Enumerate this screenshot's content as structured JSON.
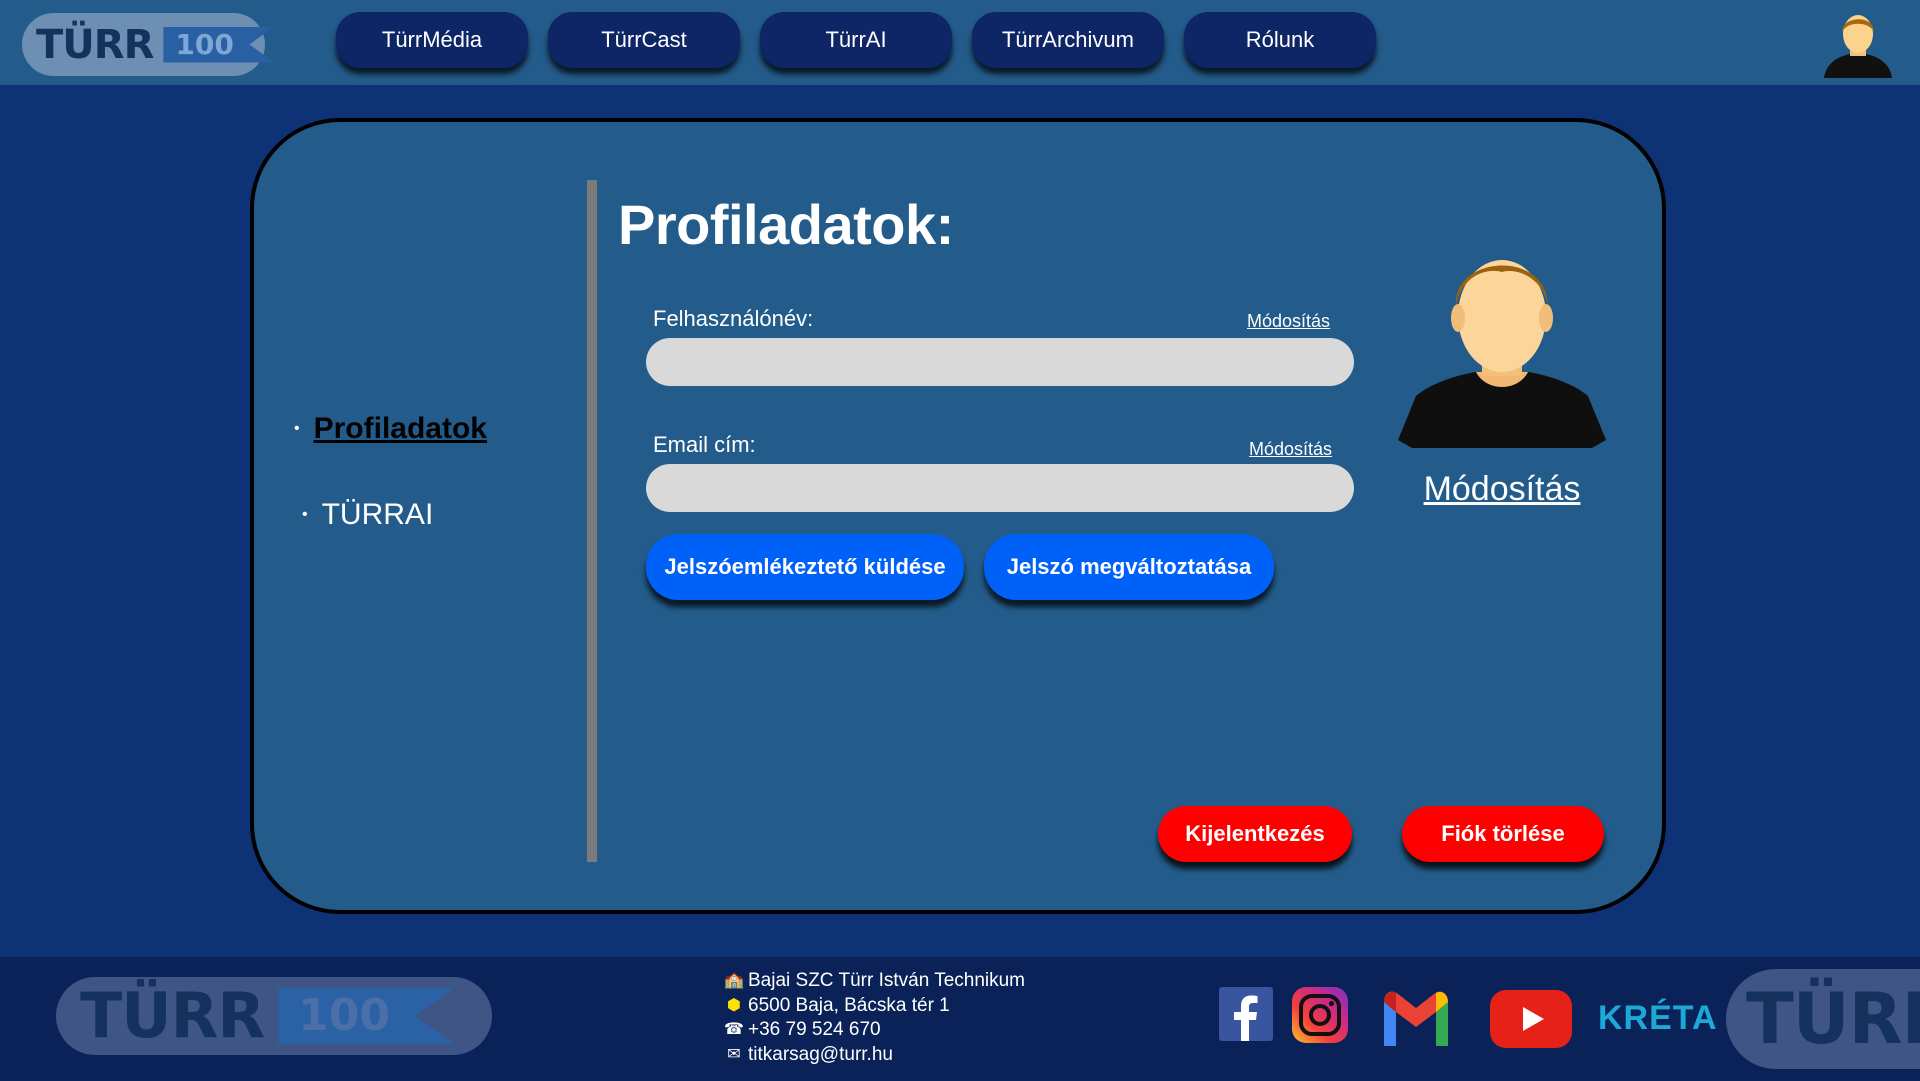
{
  "header": {
    "logo": {
      "word": "TÜRR",
      "badge": "100"
    },
    "nav": [
      {
        "label": "TürrMédia"
      },
      {
        "label": "TürrCast"
      },
      {
        "label": "TürrAI"
      },
      {
        "label": "TürrArchivum"
      },
      {
        "label": "Rólunk"
      }
    ]
  },
  "sidebar": {
    "items": [
      {
        "label": "Profiladatok",
        "active": true
      },
      {
        "label": "TÜRRAI",
        "active": false
      }
    ]
  },
  "profile": {
    "title": "Profiladatok:",
    "username": {
      "label": "Felhasználónév:",
      "edit_link": "Módosítás",
      "value": ""
    },
    "email": {
      "label": "Email cím:",
      "edit_link": "Módosítás",
      "value": ""
    },
    "buttons": {
      "send_reminder": "Jelszóemlékeztető küldése",
      "change_password": "Jelszó megváltoztatása",
      "logout": "Kijelentkezés",
      "delete_account": "Fiók törlése"
    },
    "avatar_edit": "Módosítás"
  },
  "footer": {
    "logo": {
      "word": "TÜRR",
      "badge": "100"
    },
    "logo_right": {
      "word": "TÜRR"
    },
    "contact": {
      "school": "Bajai SZC Türr István Technikum",
      "address": "6500 Baja, Bácska tér 1",
      "phone": "+36 79 524 670",
      "email": "titkarsag@turr.hu"
    },
    "social": {
      "icons": [
        "facebook-icon",
        "instagram-icon",
        "gmail-icon",
        "youtube-icon"
      ],
      "kreta": "KRÉTA"
    }
  },
  "colors": {
    "page_bg": "#0d3275",
    "header_bg": "#235c8b",
    "nav_btn": "#0e2566",
    "panel_bg": "#235c8b",
    "input_bg": "#d9d9d9",
    "primary_btn": "#0061f9",
    "danger_btn": "#ff0000",
    "footer_bg": "#0a2258"
  }
}
